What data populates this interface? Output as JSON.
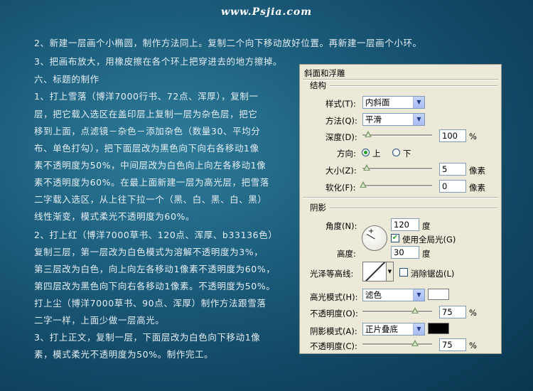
{
  "watermark": "www.Psjia.com",
  "tutorial": {
    "lines": [
      "2、新建一层画个小椭圆，制作方法同上。复制二个向下移动放好位置。再新建一层画个小环。",
      "3、把画布放大，用橡皮擦在各个环上把穿进去的地方擦掉。",
      "六、标题的制作",
      "1、打上雪落（博洋7000行书、72点、浑厚），复制一",
      "层，把它载入选区在盖印层上复制一层为杂色层，把它",
      "移到上面，点滤镜－杂色－添加杂色（数量30、平均分",
      "布、单色打勾），把下面层改为黑色向下向右各移动1像",
      "素不透明度为50%，中间层改为白色向上向左各移动1像",
      "素不透明度为60%。在最上面新建一层为高光层，把雪落",
      "二字载入选区，从上往下拉一个（黑、白、黑、白、黑）",
      "线性渐变，模式柔光不透明度为60%。",
      "2、打上红（博洋7000草书、120点、浑厚、b33136色）",
      "复制三层，第一层改为白色模式为溶解不透明度为3%，",
      "第三层改为白色，向上向左各移动1像素不透明度为60%，",
      "第四层改为黑色向下向右各移动1像素。不透明度为50%。",
      "打上尘（博洋7000草书、90点、浑厚）制作方法跟雪落",
      "二字一样，上面少做一层高光。",
      "3、打上正文，复制一层，下面层改为白色向下移动1像",
      "素，模式柔光不透明度为50%。制作完工。"
    ]
  },
  "dialog": {
    "title": "斜面和浮雕",
    "structure": {
      "header": "结构",
      "style_label": "样式(T):",
      "style_value": "内斜面",
      "technique_label": "方法(Q):",
      "technique_value": "平滑",
      "depth_label": "深度(D):",
      "depth_value": "100",
      "depth_unit": "%",
      "direction_label": "方向:",
      "direction_up": "上",
      "direction_down": "下",
      "direction_selected": "up",
      "size_label": "大小(Z):",
      "size_value": "5",
      "size_unit": "像素",
      "soften_label": "软化(F):",
      "soften_value": "0",
      "soften_unit": "像素"
    },
    "shading": {
      "header": "阴影",
      "angle_label": "角度(N):",
      "angle_value": "120",
      "angle_unit": "度",
      "global_light_label": "使用全局光(G)",
      "global_light_checked": true,
      "altitude_label": "高度:",
      "altitude_value": "30",
      "altitude_unit": "度",
      "gloss_contour_label": "光泽等高线:",
      "antialiased_label": "消除锯齿(L)",
      "antialiased_checked": false,
      "highlight_mode_label": "高光模式(H):",
      "highlight_mode_value": "滤色",
      "highlight_color": "#ffffff",
      "highlight_opacity_label": "不透明度(O):",
      "highlight_opacity_value": "75",
      "shadow_mode_label": "阴影模式(A):",
      "shadow_mode_value": "正片叠底",
      "shadow_color": "#000000",
      "shadow_opacity_label": "不透明度(C):",
      "shadow_opacity_value": "75",
      "percent_unit": "%"
    }
  }
}
